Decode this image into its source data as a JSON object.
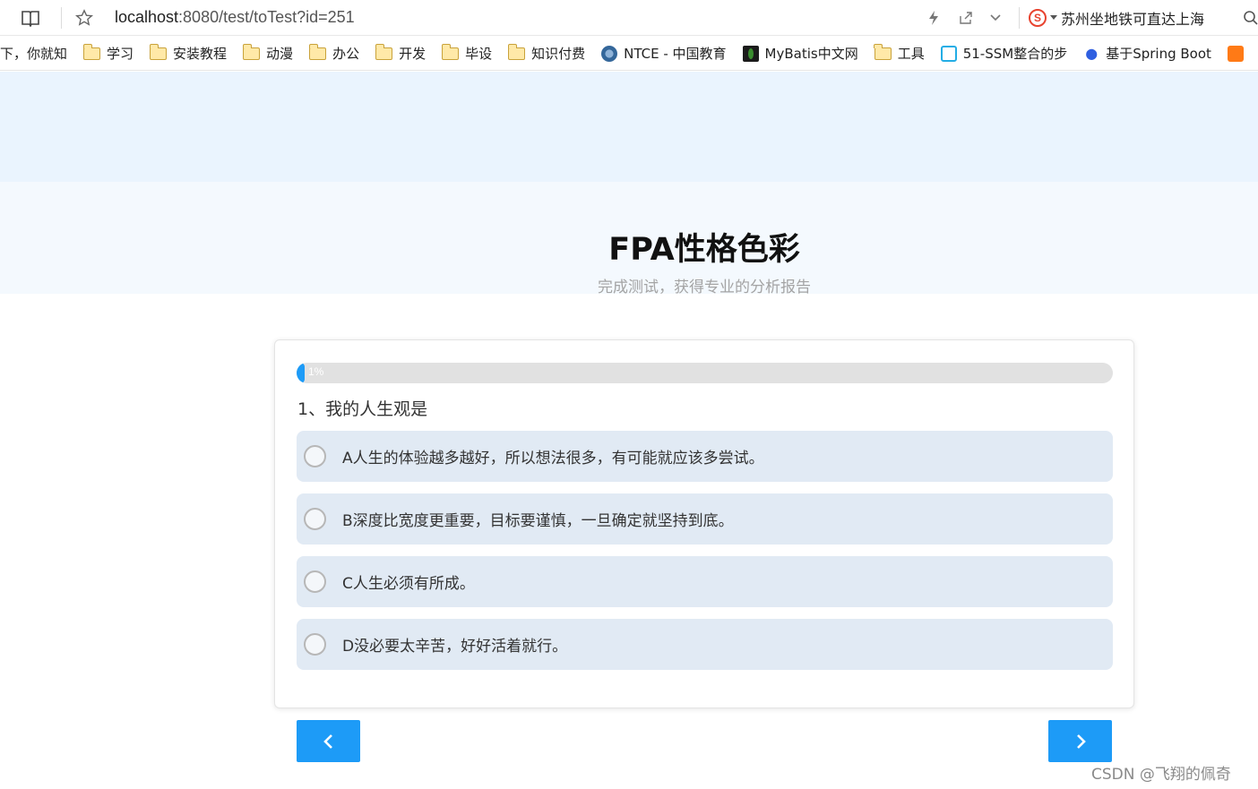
{
  "browser": {
    "url_host": "localhost",
    "url_rest": ":8080/test/toTest?id=251",
    "sogou_text": "苏州坐地铁可直达上海",
    "icons": [
      "reader-icon",
      "star-icon",
      "lightning-icon",
      "share-icon",
      "chevron-down-icon",
      "sogou-icon",
      "search-icon"
    ]
  },
  "bookmarks": [
    {
      "label": "下，你就知",
      "icon": "none"
    },
    {
      "label": "学习",
      "icon": "folder-icon"
    },
    {
      "label": "安装教程",
      "icon": "folder-icon"
    },
    {
      "label": "动漫",
      "icon": "folder-icon"
    },
    {
      "label": "办公",
      "icon": "folder-icon"
    },
    {
      "label": "开发",
      "icon": "folder-icon"
    },
    {
      "label": "毕设",
      "icon": "folder-icon"
    },
    {
      "label": "知识付费",
      "icon": "folder-icon"
    },
    {
      "label": "NTCE - 中国教育",
      "icon": "ntce-icon"
    },
    {
      "label": "MyBatis中文网",
      "icon": "mybatis-icon"
    },
    {
      "label": "工具",
      "icon": "folder-icon"
    },
    {
      "label": "51-SSM整合的步",
      "icon": "bilibili-icon"
    },
    {
      "label": "基于Spring Boot",
      "icon": "baidu-icon"
    }
  ],
  "page": {
    "title": "FPA性格色彩",
    "subtitle": "完成测试，获得专业的分析报告"
  },
  "quiz": {
    "progress_percent": 1,
    "progress_text": "1%",
    "question": "1、我的人生观是",
    "options": [
      {
        "label": "A人生的体验越多越好，所以想法很多，有可能就应该多尝试。"
      },
      {
        "label": "B深度比宽度更重要，目标要谨慎，一旦确定就坚持到底。"
      },
      {
        "label": "C人生必须有所成。"
      },
      {
        "label": "D没必要太辛苦，好好活着就行。"
      }
    ]
  },
  "colors": {
    "accent": "#1d9bf7",
    "option_bg": "#e1eaf4",
    "hero_top": "#eaf4fe",
    "hero_bottom": "#f4f9fe"
  },
  "watermark": "CSDN @飞翔的佩奇"
}
